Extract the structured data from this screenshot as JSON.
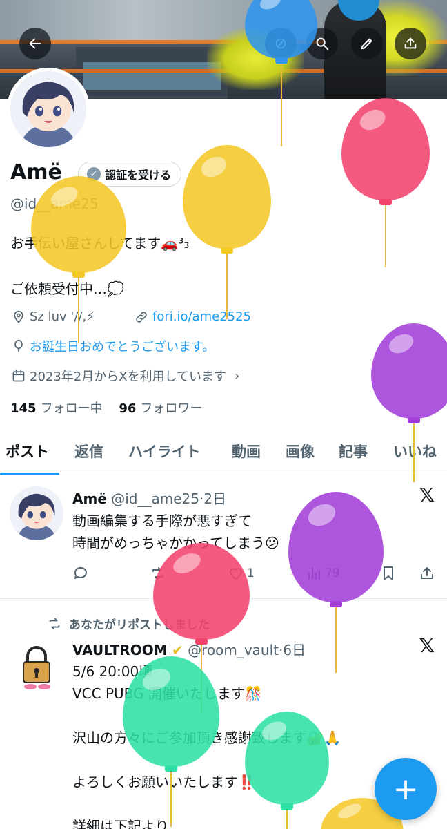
{
  "header": {
    "back_icon": "arrow-left-icon",
    "controls": [
      "search-icon",
      "edit-pencil-icon",
      "share-upload-icon"
    ]
  },
  "profile": {
    "name": "Amë",
    "verify_label": "認証を受ける",
    "handle": "@id__ame25",
    "bio_line1": "お手伝い屋さんしてます🚗³₃",
    "bio_line2": "ご依頼受付中…💭",
    "location": "Sz luv '//,⚡",
    "website": "fori.io/ame2525",
    "birthday": "お誕生日おめでとうございます。",
    "joined": "2023年2月からXを利用しています",
    "following_count": "145",
    "following_label": "フォロー中",
    "followers_count": "96",
    "followers_label": "フォロワー"
  },
  "tabs": [
    "ポスト",
    "返信",
    "ハイライト",
    "動画",
    "画像",
    "記事",
    "いいね"
  ],
  "posts": [
    {
      "author": "Amë",
      "handle": "@id__ame25",
      "time": "·2日",
      "lines": [
        "動画編集する手際が悪すぎて",
        "時間がめっちゃかかってしまう😕"
      ],
      "likes": "1",
      "views": "79"
    },
    {
      "repost_note": "あなたがリポストしました",
      "author": "VAULTROOM",
      "handle": "@room_vault",
      "time": "·6日",
      "lines": [
        "5/6 20:00頃",
        "VCC PUBG 開催いたします🎊",
        "",
        "沢山の方々にご参加頂き感謝致します🔐🙏",
        "",
        "よろしくお願いいたします‼️",
        "",
        "詳細は下記より"
      ]
    }
  ],
  "fab_label": "+",
  "colors": {
    "accent": "#1d9bf0",
    "text": "#0f1419",
    "muted": "#536471",
    "balloon_yellow": "#f4c728",
    "balloon_pink": "#f2436d",
    "balloon_purple": "#a23fd8",
    "balloon_green": "#2ee0a5",
    "balloon_blue": "#2f95ee"
  }
}
